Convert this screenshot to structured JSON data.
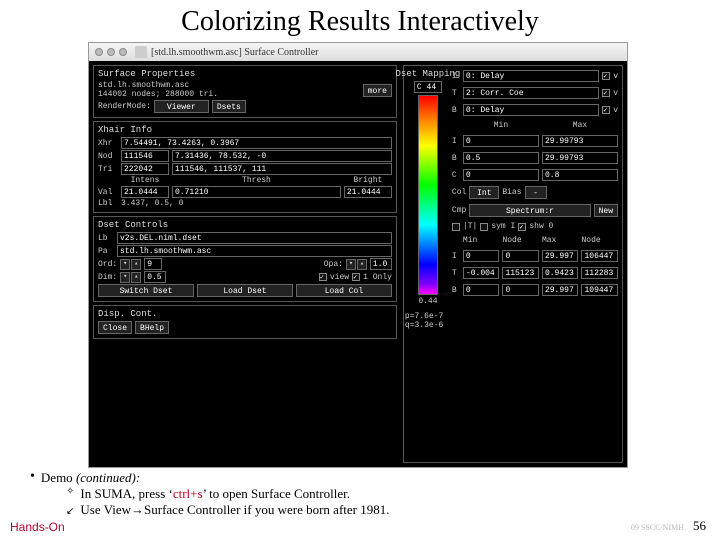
{
  "title": "Colorizing Results Interactively",
  "window": {
    "title": "[std.lh.smoothwm.asc] Surface Controller"
  },
  "surfProps": {
    "header": "Surface Properties",
    "line1": "std.lh.smoothwm.asc",
    "line2": "144002 nodes; 288000 tri.",
    "moreBtn": "more",
    "renderLabel": "RenderMode:",
    "renderValue": "Viewer",
    "dsetsBtn": "Dsets"
  },
  "xhair": {
    "header": "Xhair Info",
    "xhrLabel": "Xhr",
    "xhrValue": "7.54491, 73.4263, 0.3967",
    "nodLabel": "Nod",
    "nodA": "111546",
    "nodB": "7.31436, 78.532, -0",
    "triLabel": "Tri",
    "triA": "222042",
    "triB": "111546, 111537, 111",
    "intensLabel": "Intens",
    "threshLabel": "Thresh",
    "brightLabel": "Bright",
    "valLabel": "Val",
    "valA": "21.0444",
    "valB": "0.71210",
    "valC": "21.0444",
    "lblLabel": "Lbl",
    "lblValue": "3.437, 0.5, 0"
  },
  "dsetCtrl": {
    "header": "Dset Controls",
    "lbLabel": "Lb",
    "lbValue": "v2s.DEL.niml.dset",
    "paLabel": "Pa",
    "paValue": "std.lh.smoothwm.asc",
    "ordLabel": "Ord:",
    "ordValue": "9",
    "opaLabel": "Opa:",
    "opaValue": "1.0",
    "dimLabel": "Dim:",
    "dimValue": "0.5",
    "viewLabel": "view",
    "onlyLabel": "1 Only",
    "switchBtn": "Switch Dset",
    "loadDsetBtn": "Load Dset",
    "loadColBtn": "Load Col"
  },
  "dispCont": {
    "header": "Disp. Cont.",
    "closeBtn": "Close",
    "bhelpBtn": "BHelp"
  },
  "dsetMap": {
    "header": "Dset Mapping",
    "bar_top": "C 44",
    "bar_mid": "0.44",
    "i_label": "I",
    "i_value": "0: Delay",
    "t_label": "T",
    "t_value": "2: Corr. Coe",
    "b_label": "B",
    "b_value": "0: Delay",
    "min": "Min",
    "max": "Max",
    "i_min": "0",
    "i_max": "29.99793",
    "b_min": "0.5",
    "b_max": "29.99793",
    "c_min": "0",
    "c_max": "0.8",
    "c_label": "C",
    "colLabel": "Col",
    "colValue": "Int",
    "biasLabel": "Bias",
    "cmpLabel": "Cmp",
    "cmpValue": "Spectrum:r",
    "newBtn": "New",
    "absLabel": "|T|",
    "symLabel": "sym I",
    "shwLabel": "shw 0",
    "pq": "p=7.6e-7\nq=3.3e-6",
    "tblHdr1": "Min",
    "tblHdr2": "Node",
    "tblHdr3": "Max",
    "tblHdr4": "Node",
    "rI_min": "0",
    "rI_node1": "0",
    "rI_max": "29.997",
    "rI_node2": "106447",
    "rT_min": "-0.004",
    "rT_node1": "115123",
    "rT_max": "0.9423",
    "rT_node2": "112283",
    "rB_min": "0",
    "rB_node1": "0",
    "rB_max": "29.997",
    "rB_node2": "109447"
  },
  "bullets": {
    "demo": "Demo",
    "cont": " (continued):",
    "sub1_pre": "In SUMA, press ‘",
    "sub1_key": "ctrl+s",
    "sub1_post": "’ to open Surface Controller.",
    "sub2_a": "Use View",
    "sub2_b": "Surface Controller if you were born after 1981."
  },
  "footer": {
    "handsOn": "Hands-On",
    "credit": "09 SSCC/NIMH",
    "pageNum": "56"
  }
}
